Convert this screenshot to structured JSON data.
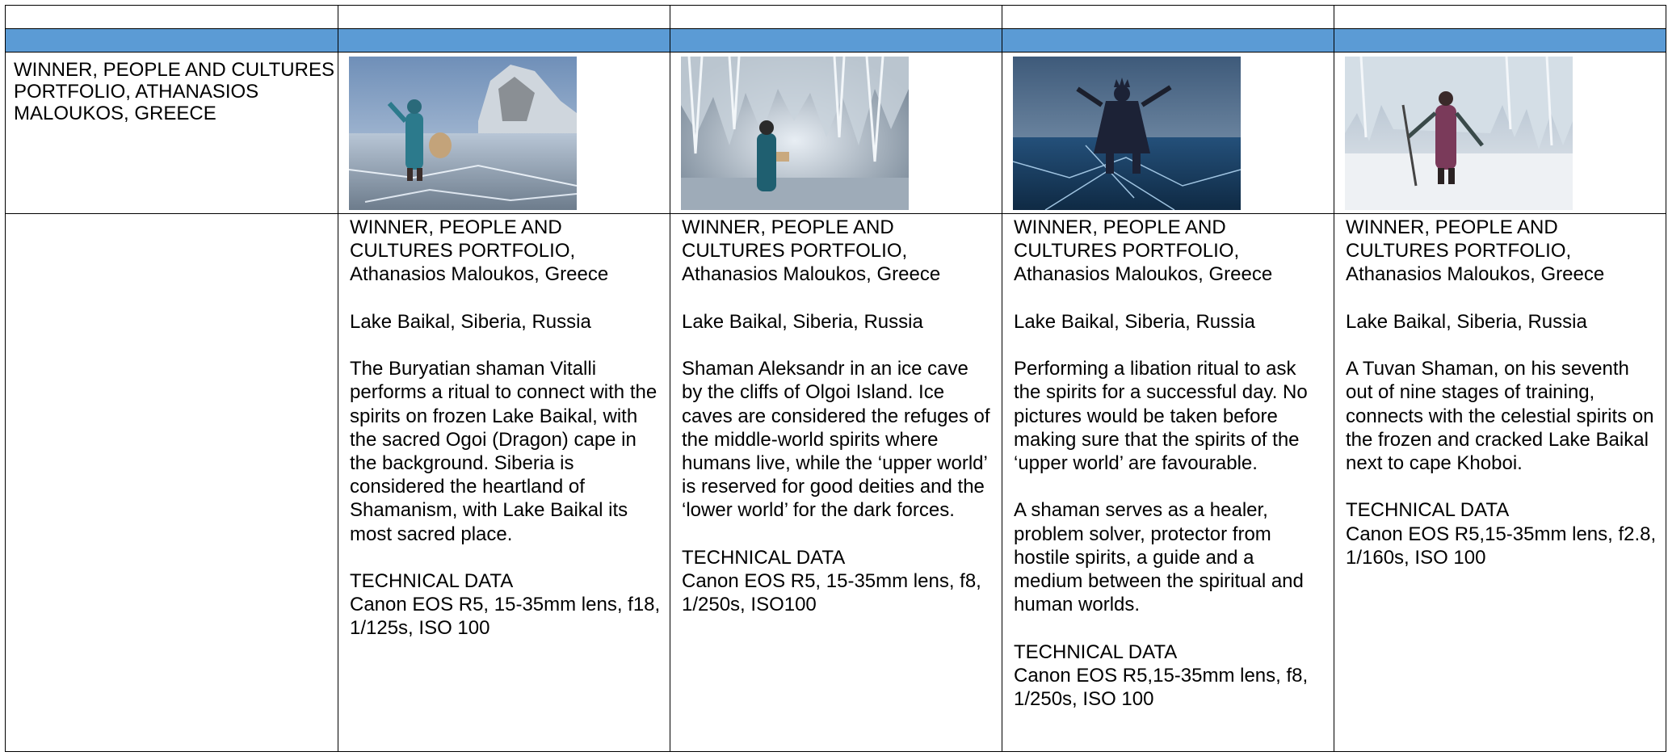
{
  "header_cell": "WINNER, PEOPLE AND CULTURES PORTFOLIO, ATHANASIOS MALOUKOS, GREECE",
  "captions": [
    {
      "title": "WINNER, PEOPLE AND CULTURES PORTFOLIO,",
      "credit": "Athanasios Maloukos, Greece",
      "location": "Lake Baikal, Siberia, Russia",
      "description": [
        "The Buryatian shaman Vitalli performs a ritual to connect with the spirits on frozen Lake Baikal, with the sacred Ogoi (Dragon) cape in the background. Siberia is considered the heartland of Shamanism, with Lake Baikal its most sacred place."
      ],
      "tech_label": "TECHNICAL DATA",
      "tech": "Canon EOS R5, 15-35mm lens, f18, 1/125s, ISO 100"
    },
    {
      "title": "WINNER, PEOPLE AND CULTURES PORTFOLIO,",
      "credit": "Athanasios Maloukos, Greece",
      "location": "Lake Baikal, Siberia, Russia",
      "description": [
        "Shaman Aleksandr in an ice cave by the cliffs of Olgoi Island. Ice caves are considered the refuges of the middle-world spirits where humans live, while the ‘upper world’ is reserved for good deities and the ‘lower world’ for the dark forces."
      ],
      "tech_label": "TECHNICAL DATA",
      "tech": "Canon EOS R5, 15-35mm lens, f8, 1/250s, ISO100"
    },
    {
      "title": "WINNER, PEOPLE AND CULTURES PORTFOLIO,",
      "credit": "Athanasios Maloukos, Greece",
      "location": "Lake Baikal, Siberia, Russia",
      "description": [
        "Performing a libation ritual to ask the spirits for a successful day. No pictures would be taken before making sure that the spirits of the ‘upper world’ are favourable.",
        "A shaman serves as a healer, problem solver, protector from hostile spirits, a guide and a medium between the spiritual and human worlds."
      ],
      "tech_label": "TECHNICAL DATA",
      "tech": "Canon EOS R5,15-35mm lens, f8, 1/250s, ISO 100"
    },
    {
      "title": "WINNER, PEOPLE AND CULTURES PORTFOLIO,",
      "credit": "Athanasios Maloukos, Greece",
      "location": "Lake Baikal, Siberia, Russia",
      "description": [
        "A Tuvan Shaman, on his seventh out of nine stages of training, connects with the celestial spirits on the frozen and cracked Lake Baikal next to cape Khoboi."
      ],
      "tech_label": "TECHNICAL DATA",
      "tech": "Canon EOS R5,15-35mm lens, f2.8, 1/160s, ISO 100"
    }
  ],
  "colors": {
    "header_band": "#5b9bd5"
  },
  "image_alts": [
    "shaman-on-frozen-lake-photo",
    "shaman-in-ice-cave-photo",
    "shaman-libation-ritual-photo",
    "tuvan-shaman-photo"
  ]
}
